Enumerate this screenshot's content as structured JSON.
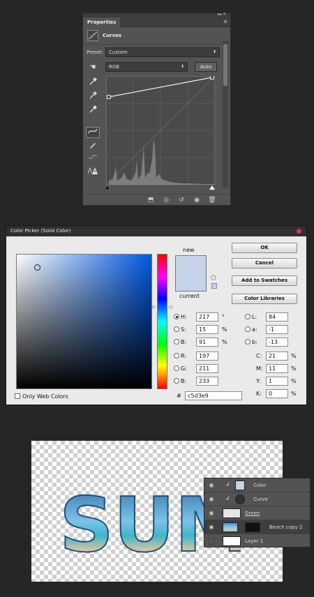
{
  "properties_panel": {
    "tab_label": "Properties",
    "panel_title": "Curves",
    "preset_label": "Preset:",
    "preset_value": "Custom",
    "channel_value": "RGB",
    "auto_label": "Auto"
  },
  "color_picker": {
    "title": "Color Picker (Solid Color)",
    "new_label": "new",
    "current_label": "current",
    "ok_label": "OK",
    "cancel_label": "Cancel",
    "add_swatches_label": "Add to Swatches",
    "color_libraries_label": "Color Libraries",
    "only_web_colors_label": "Only Web Colors",
    "fields": {
      "h_label": "H:",
      "h_value": "217",
      "h_unit": "°",
      "s_label": "S:",
      "s_value": "15",
      "s_unit": "%",
      "b_label": "B:",
      "b_value": "91",
      "b_unit": "%",
      "r_label": "R:",
      "r_value": "197",
      "g_label": "G:",
      "g_value": "211",
      "b2_label": "B:",
      "b2_value": "233",
      "l_label": "L:",
      "l_value": "84",
      "a_label": "a:",
      "a_value": "-1",
      "lab_b_label": "b:",
      "lab_b_value": "-13",
      "c_label": "C:",
      "c_value": "21",
      "c_unit": "%",
      "m_label": "M:",
      "m_value": "11",
      "m_unit": "%",
      "y_label": "Y:",
      "y_value": "1",
      "y_unit": "%",
      "k_label": "K:",
      "k_value": "0",
      "k_unit": "%"
    },
    "hex_label": "#",
    "hex_value": "c5d3e9",
    "swatch_color": "#c5d3e9"
  },
  "canvas": {
    "art_text": "SUMMER"
  },
  "layers": [
    {
      "name": "Color",
      "visible": true,
      "clipped": true
    },
    {
      "name": "Curve",
      "visible": true,
      "clipped": true
    },
    {
      "name": "Green",
      "visible": true,
      "clipped": false
    },
    {
      "name": "Beach copy 2",
      "visible": true,
      "clipped": false
    },
    {
      "name": "Layer 1",
      "visible": false,
      "clipped": false
    }
  ],
  "icons": [
    "curves-icon",
    "hand-icon",
    "eyedropper-icon",
    "curve-tool-icon",
    "pencil-icon",
    "smooth-icon",
    "warning-icon",
    "eye-icon",
    "cube-icon"
  ]
}
